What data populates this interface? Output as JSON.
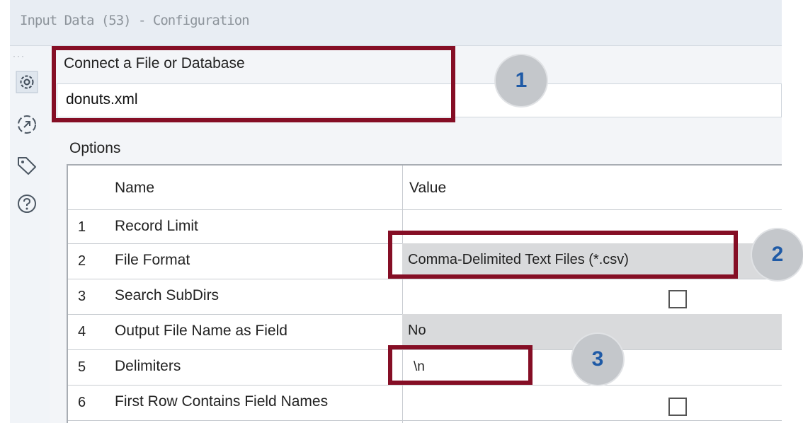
{
  "window": {
    "title": "Input Data (53) - Configuration"
  },
  "sidebar": {
    "icons": [
      "gear-icon",
      "share-icon",
      "tag-icon",
      "help-icon"
    ]
  },
  "connect": {
    "label": "Connect a File or Database",
    "value": "donuts.xml"
  },
  "options": {
    "label": "Options",
    "columns": {
      "name": "Name",
      "value": "Value"
    },
    "rows": [
      {
        "num": "1",
        "name": "Record Limit",
        "value": ""
      },
      {
        "num": "2",
        "name": "File Format",
        "value": "Comma-Delimited Text Files (*.csv)"
      },
      {
        "num": "3",
        "name": "Search SubDirs",
        "value": "",
        "checked": false
      },
      {
        "num": "4",
        "name": "Output File Name as Field",
        "value": "No"
      },
      {
        "num": "5",
        "name": "Delimiters",
        "value": "\\n"
      },
      {
        "num": "6",
        "name": "First Row Contains Field Names",
        "value": "",
        "checked": false
      }
    ]
  },
  "callouts": [
    "1",
    "2",
    "3"
  ],
  "colors": {
    "highlight": "#850e25",
    "badge_text": "#1f5aa6",
    "badge_bg": "#c4c7cb"
  }
}
